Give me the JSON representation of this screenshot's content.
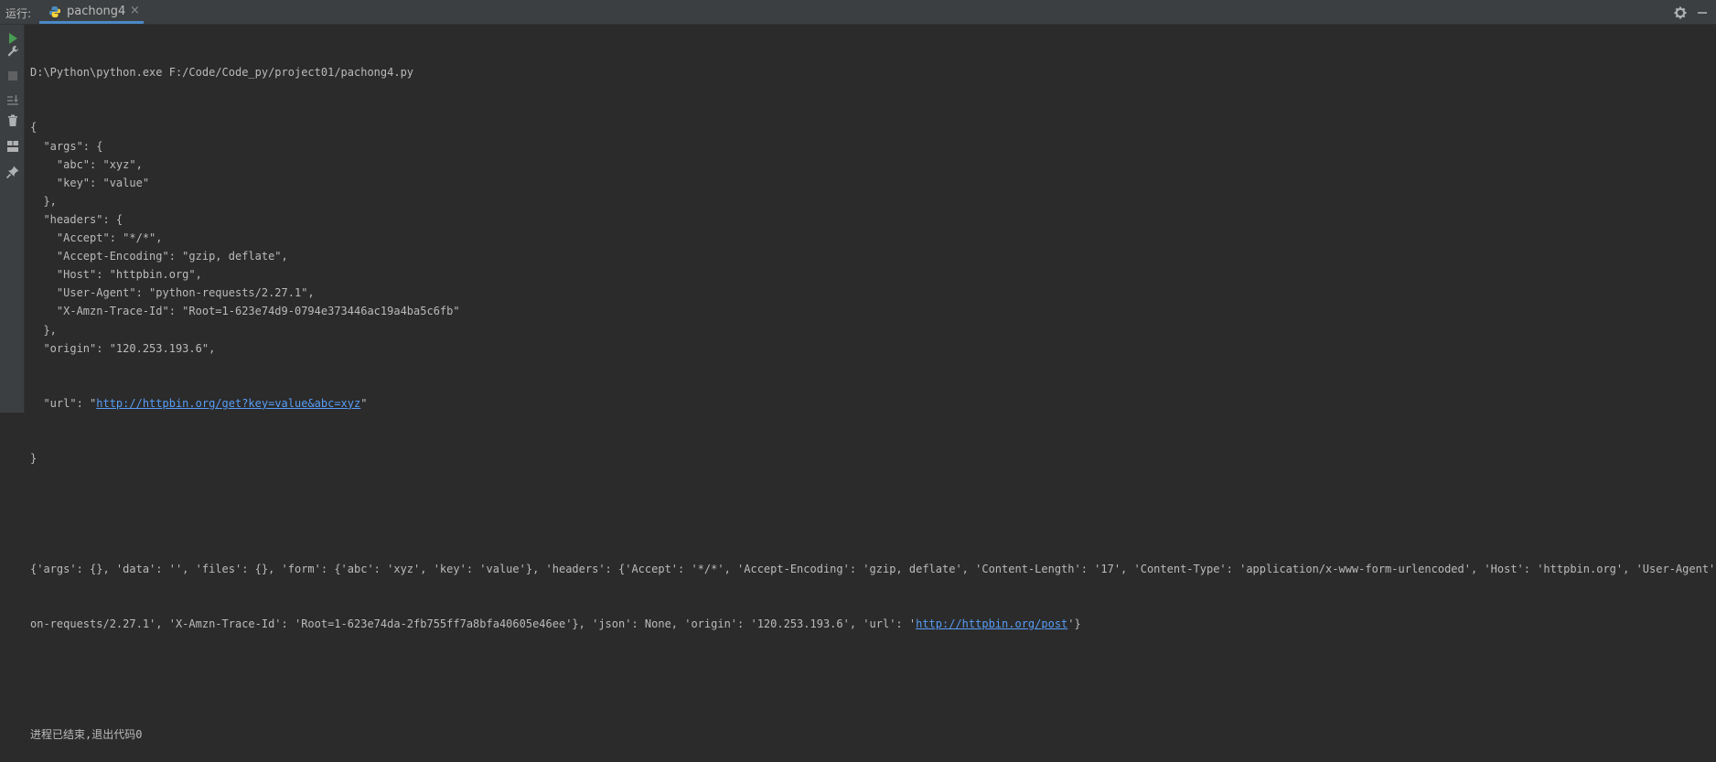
{
  "toolbar": {
    "run_label": "运行:",
    "tab_label": "pachong4",
    "tab_close": "×"
  },
  "icons": {
    "tab": "python-file-icon",
    "settings": "gear-icon",
    "minimize": "minimize-icon",
    "sidebar": [
      "run-icon",
      "wrench-icon",
      "stop-icon",
      "sort-icon",
      "trash-icon",
      "layout-icon",
      "pin-icon"
    ]
  },
  "console": {
    "command": "D:\\Python\\python.exe F:/Code/Code_py/project01/pachong4.py",
    "json_lines": [
      "{",
      "  \"args\": {",
      "    \"abc\": \"xyz\",",
      "    \"key\": \"value\"",
      "  },",
      "  \"headers\": {",
      "    \"Accept\": \"*/*\",",
      "    \"Accept-Encoding\": \"gzip, deflate\",",
      "    \"Host\": \"httpbin.org\",",
      "    \"User-Agent\": \"python-requests/2.27.1\",",
      "    \"X-Amzn-Trace-Id\": \"Root=1-623e74d9-0794e373446ac19a4ba5c6fb\"",
      "  },",
      "  \"origin\": \"120.253.193.6\","
    ],
    "url_prefix": "  \"url\": \"",
    "url_link": "http://httpbin.org/get?key=value&abc=xyz",
    "url_suffix": "\"",
    "json_close": "}",
    "dict_line1": "{'args': {}, 'data': '', 'files': {}, 'form': {'abc': 'xyz', 'key': 'value'}, 'headers': {'Accept': '*/*', 'Accept-Encoding': 'gzip, deflate', 'Content-Length': '17', 'Content-Type': 'application/x-www-form-urlencoded', 'Host': 'httpbin.org', 'User-Agent': 'pyth",
    "dict_line2_prefix": "on-requests/2.27.1', 'X-Amzn-Trace-Id': 'Root=1-623e74da-2fb755ff7a8bfa40605e46ee'}, 'json': None, 'origin': '120.253.193.6', 'url': '",
    "dict_line2_link": "http://httpbin.org/post",
    "dict_line2_suffix": "'}",
    "exit_line": "进程已结束,退出代码0"
  },
  "colors": {
    "background": "#2b2b2b",
    "panel": "#3c3f41",
    "text": "#bbbbbb",
    "link": "#589df6",
    "tab_underline": "#4a88c7",
    "run_green": "#499c54"
  }
}
